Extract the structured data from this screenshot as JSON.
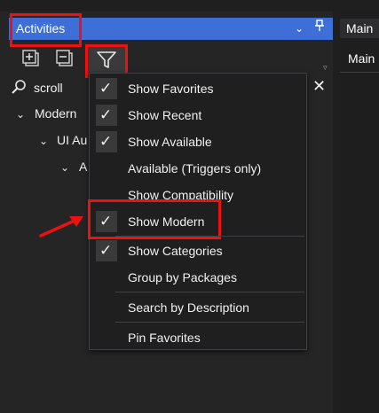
{
  "panel": {
    "title": "Activities",
    "title_icons": "⌄",
    "pin_icon": "pin-icon"
  },
  "toolbar": {
    "expand_icon": "expand-all-icon",
    "collapse_icon": "collapse-all-icon",
    "filter_icon": "filter-icon"
  },
  "search": {
    "value": "scroll"
  },
  "tree": {
    "items": [
      {
        "label": "Modern"
      },
      {
        "label": "UI Au"
      },
      {
        "label": "A"
      }
    ]
  },
  "right_pane": {
    "tab": "Main",
    "subtab": "Main"
  },
  "menu": {
    "items": [
      {
        "label": "Show Favorites",
        "checked": true
      },
      {
        "label": "Show Recent",
        "checked": true
      },
      {
        "label": "Show Available",
        "checked": true
      },
      {
        "label": "Available (Triggers only)",
        "checked": false
      },
      {
        "label": "Show Compatibility",
        "checked": false
      },
      {
        "label": "Show Modern",
        "checked": true
      },
      {
        "label": "Show Categories",
        "checked": true
      },
      {
        "label": "Group by Packages",
        "checked": false
      },
      {
        "label": "Search by Description",
        "checked": false
      },
      {
        "label": "Pin Favorites",
        "checked": false
      }
    ]
  },
  "colors": {
    "title_bar": "#3e6fd6",
    "highlight": "#e11111",
    "menu_bg": "#1f1f1f"
  }
}
